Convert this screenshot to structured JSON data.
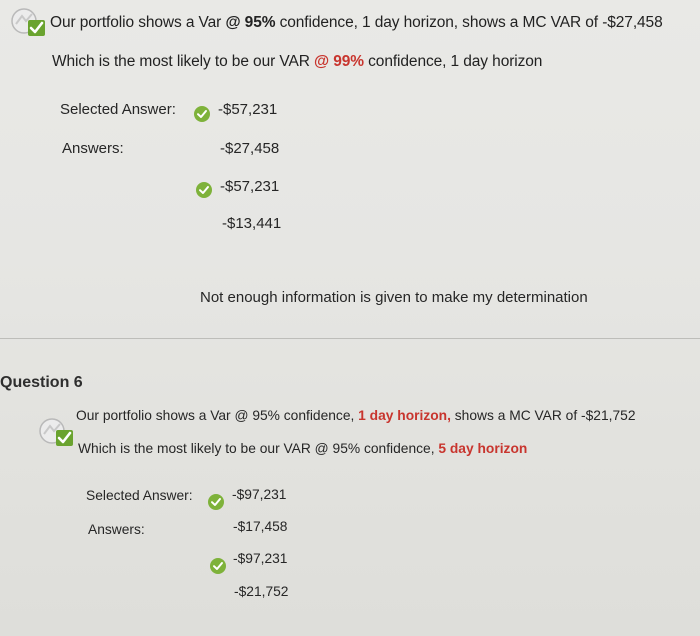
{
  "q5": {
    "line1_a": "Our portfolio shows a Var ",
    "line1_b": "@ 95%",
    "line1_c": " confidence, 1 day horizon, shows a MC VAR of -$27,458",
    "line2_a": "Which is the most likely to be our VAR ",
    "line2_b": "@ 99%",
    "line2_c": " confidence, 1 day horizon",
    "selected_label": "Selected Answer:",
    "selected_value": "-$57,231",
    "answers_label": "Answers:",
    "answers": [
      "-$27,458",
      "-$57,231",
      "-$13,441",
      "Not enough information is given to make my determination"
    ],
    "correct_index": 1
  },
  "q6": {
    "heading": "Question 6",
    "line1_a": "Our portfolio shows a Var @ 95% confidence, ",
    "line1_b": "1 day horizon,",
    "line1_c": " shows a MC VAR of -$21,752",
    "line2_a": "Which is the most likely to be our VAR  @ 95% confidence, ",
    "line2_b": "5 day horizon",
    "selected_label": "Selected Answer:",
    "selected_value": "-$97,231",
    "answers_label": "Answers:",
    "answers": [
      "-$17,458",
      "-$97,231",
      "-$21,752"
    ],
    "correct_index": 1
  },
  "colors": {
    "accent_red": "#c8352e",
    "check_green": "#7eb23a",
    "background": "#e6e6e3"
  },
  "icons": [
    "correct-question-icon",
    "check-circle-icon"
  ]
}
